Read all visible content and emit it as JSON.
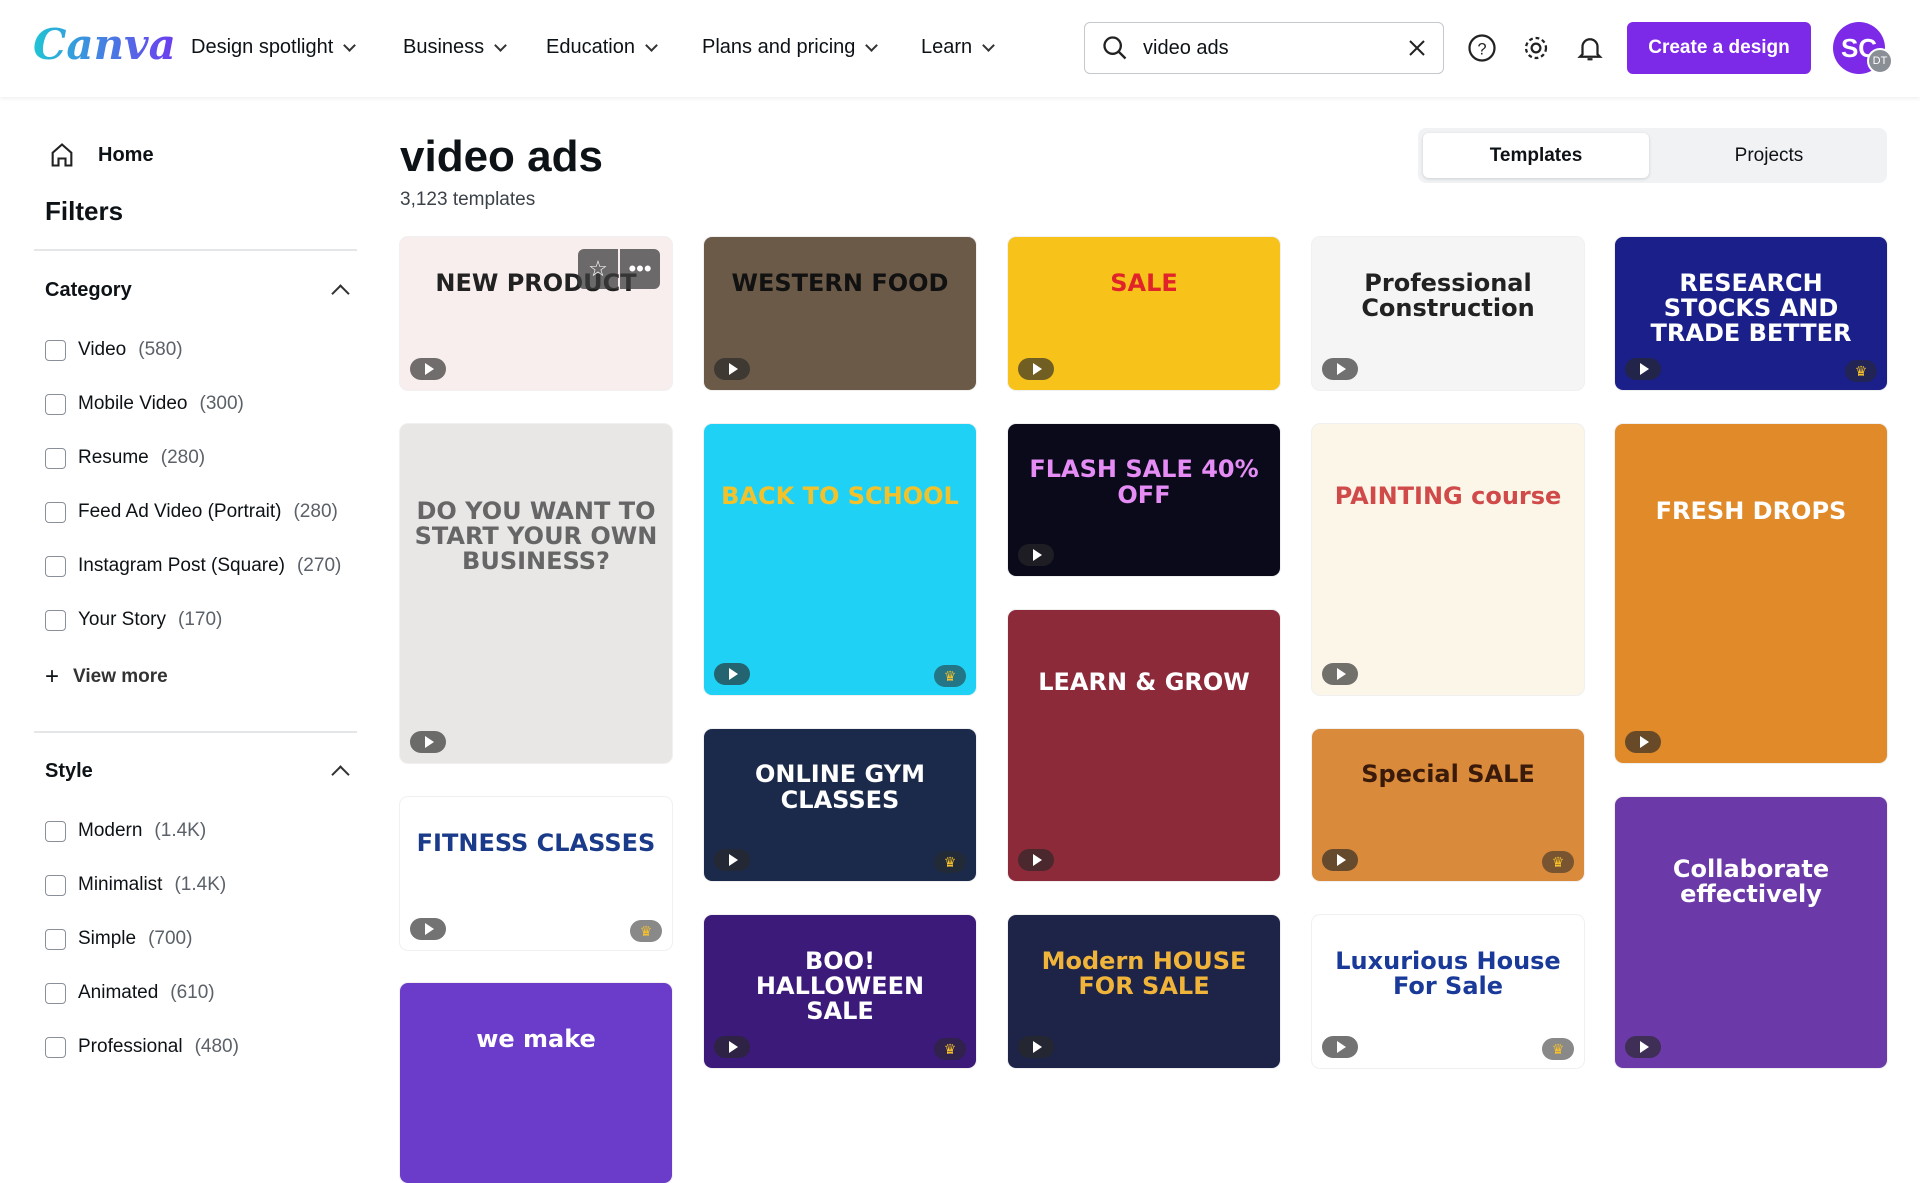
{
  "header": {
    "logo": "Canva",
    "nav": [
      {
        "label": "Design spotlight"
      },
      {
        "label": "Business"
      },
      {
        "label": "Education"
      },
      {
        "label": "Plans and pricing"
      },
      {
        "label": "Learn"
      }
    ],
    "search_value": "video ads",
    "create_label": "Create a design",
    "avatar_initials": "SC",
    "avatar_secondary": "DT",
    "accent": "#7d2ae8"
  },
  "sidebar": {
    "home": "Home",
    "filters": "Filters",
    "category": {
      "title": "Category",
      "items": [
        {
          "label": "Video",
          "count": "(580)"
        },
        {
          "label": "Mobile Video",
          "count": "(300)"
        },
        {
          "label": "Resume",
          "count": "(280)"
        },
        {
          "label": "Feed Ad Video (Portrait)",
          "count": "(280)"
        },
        {
          "label": "Instagram Post (Square)",
          "count": "(270)"
        },
        {
          "label": "Your Story",
          "count": "(170)"
        }
      ],
      "view_more": "View more"
    },
    "style": {
      "title": "Style",
      "items": [
        {
          "label": "Modern",
          "count": "(1.4K)"
        },
        {
          "label": "Minimalist",
          "count": "(1.4K)"
        },
        {
          "label": "Simple",
          "count": "(700)"
        },
        {
          "label": "Animated",
          "count": "(610)"
        },
        {
          "label": "Professional",
          "count": "(480)"
        }
      ]
    }
  },
  "main": {
    "title": "video ads",
    "count": "3,123 templates",
    "tabs": [
      {
        "label": "Templates",
        "active": true
      },
      {
        "label": "Projects",
        "active": false
      }
    ],
    "columns": [
      [
        {
          "text": "NEW PRODUCT",
          "bg": "#f8eeee",
          "fg": "#222",
          "hover": true
        },
        {
          "text": "DO YOU WANT TO START YOUR OWN BUSINESS?",
          "bg": "#e9e7e6",
          "fg": "#666"
        },
        {
          "text": "FITNESS CLASSES",
          "bg": "#ffffff",
          "fg": "#1a3a8a",
          "premium": true
        },
        {
          "text": "we make",
          "bg": "#6a3cc9",
          "fg": "#fff"
        }
      ],
      [
        {
          "text": "WESTERN FOOD",
          "bg": "#6b5a48",
          "fg": "#111"
        },
        {
          "text": "BACK TO SCHOOL",
          "bg": "#1fd2f5",
          "fg": "#f3c22a",
          "premium": true
        },
        {
          "text": "ONLINE GYM CLASSES",
          "bg": "#1b2a4a",
          "fg": "#fff",
          "premium": true
        },
        {
          "text": "BOO! HALLOWEEN SALE",
          "bg": "#3b1a7a",
          "fg": "#fff",
          "premium": true
        }
      ],
      [
        {
          "text": "SALE",
          "bg": "#f7c21a",
          "fg": "#e0242a"
        },
        {
          "text": "FLASH SALE 40% OFF",
          "bg": "#0a0a1a",
          "fg": "#e58cf5"
        },
        {
          "text": "LEARN & GROW",
          "bg": "#8c2a3a",
          "fg": "#fff"
        },
        {
          "text": "Modern HOUSE FOR SALE",
          "bg": "#1d2447",
          "fg": "#f0b43a"
        }
      ],
      [
        {
          "text": "Professional Construction",
          "bg": "#f5f5f5",
          "fg": "#222"
        },
        {
          "text": "PAINTING course",
          "bg": "#fbf6e8",
          "fg": "#d04a4a"
        },
        {
          "text": "Special SALE",
          "bg": "#d98a3a",
          "fg": "#3a1a0a",
          "premium": true
        },
        {
          "text": "Luxurious House For Sale",
          "bg": "#ffffff",
          "fg": "#1a3a9a",
          "premium": true
        }
      ],
      [
        {
          "text": "RESEARCH STOCKS AND TRADE BETTER",
          "bg": "#1a1f8a",
          "fg": "#fff",
          "premium": true
        },
        {
          "text": "FRESH DROPS",
          "bg": "#e08a2a",
          "fg": "#fff"
        },
        {
          "text": "Collaborate effectively",
          "bg": "#6b3aa8",
          "fg": "#fff"
        }
      ]
    ]
  }
}
